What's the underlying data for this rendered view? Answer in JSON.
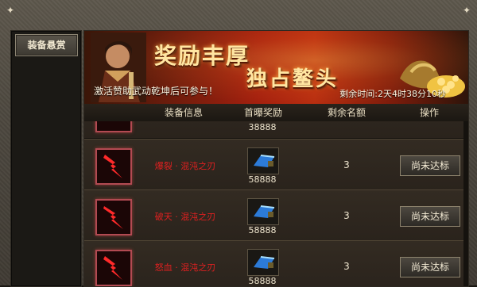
{
  "sidebar": {
    "tab_label": "装备悬赏"
  },
  "banner": {
    "title_line1": "奖励丰厚",
    "title_line2": "独占鳌头",
    "promo_text": "激活赞助武动乾坤后可参与！",
    "time_label": "剩余时间:2天4时38分10秒"
  },
  "table": {
    "headers": {
      "equip": "装备信息",
      "reward": "首曝奖励",
      "quota": "剩余名额",
      "action": "操作"
    },
    "rows": [
      {
        "name": "",
        "reward": "38888",
        "quota": "",
        "action": ""
      },
      {
        "name": "爆裂 · 混沌之刃",
        "reward": "58888",
        "quota": "3",
        "action": "尚未达标"
      },
      {
        "name": "破天 · 混沌之刃",
        "reward": "58888",
        "quota": "3",
        "action": "尚未达标"
      },
      {
        "name": "怒血 · 混沌之刃",
        "reward": "58888",
        "quota": "3",
        "action": "尚未达标"
      }
    ]
  },
  "colors": {
    "accent_red": "#e02020",
    "gold_text": "#ffe6a2"
  },
  "icons": {
    "equipment": "red-lightning-blade-icon",
    "reward": "blue-ingot-icon",
    "corner": "ornament-icon"
  }
}
